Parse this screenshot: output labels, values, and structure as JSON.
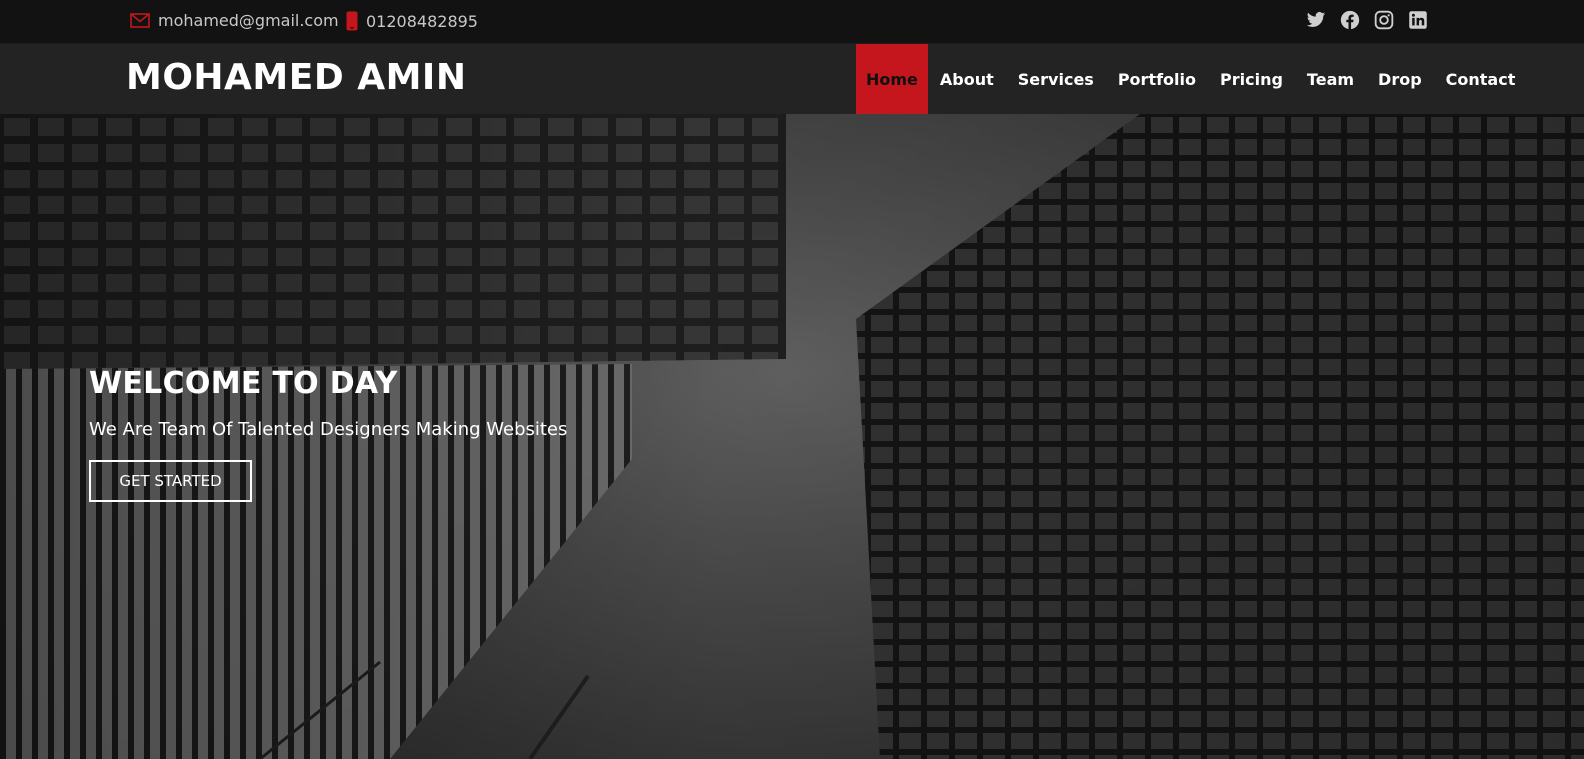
{
  "topbar": {
    "email": "mohamed@gmail.com",
    "phone": "01208482895",
    "email_icon": "envelope-icon",
    "phone_icon": "phone-icon",
    "socials": [
      "twitter-icon",
      "facebook-icon",
      "instagram-icon",
      "linkedin-icon"
    ]
  },
  "navbar": {
    "logo": "MOHAMED AMIN",
    "items": [
      {
        "label": "Home",
        "active": true
      },
      {
        "label": "About"
      },
      {
        "label": "Services"
      },
      {
        "label": "Portfolio"
      },
      {
        "label": "Pricing"
      },
      {
        "label": "Team"
      },
      {
        "label": "Drop"
      },
      {
        "label": "Contact"
      }
    ]
  },
  "hero": {
    "title": "WELCOME TO DAY",
    "subtitle": "We Are Team Of Talented Designers Making Websites",
    "button": "GET STARTED"
  },
  "colors": {
    "accent": "#c4161c",
    "topbar_bg": "#121212",
    "navbar_bg": "#232323"
  }
}
